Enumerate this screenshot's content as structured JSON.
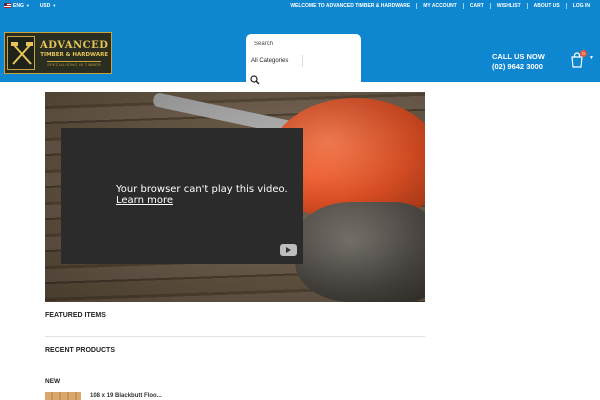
{
  "topbar": {
    "language": "ENG",
    "currency": "USD",
    "links": [
      "WELCOME TO ADVANCED TIMBER & HARDWARE",
      "MY ACCOUNT",
      "CART",
      "WISHLIST",
      "ABOUT US",
      "LOG IN"
    ]
  },
  "header": {
    "logo": {
      "line1": "ADVANCED",
      "line2": "TIMBER & HARDWARE",
      "tagline": "SPECIALISING IN TIMBER"
    },
    "search": {
      "placeholder": "Search",
      "category": "All Categories"
    },
    "call": {
      "label": "CALL US NOW",
      "phone": "(02) 9642 3000"
    },
    "cart_count": "0"
  },
  "video": {
    "message": "Your browser can't play this video.",
    "link": "Learn more"
  },
  "sections": {
    "featured": "FEATURED ITEMS",
    "recent": "RECENT PRODUCTS",
    "new_badge": "NEW",
    "product_name": "108 x 19 Blackbutt Floo..."
  },
  "colors": {
    "brand_blue": "#0e86d0",
    "logo_gold": "#c9a441",
    "logo_bg": "#2a2e20"
  }
}
